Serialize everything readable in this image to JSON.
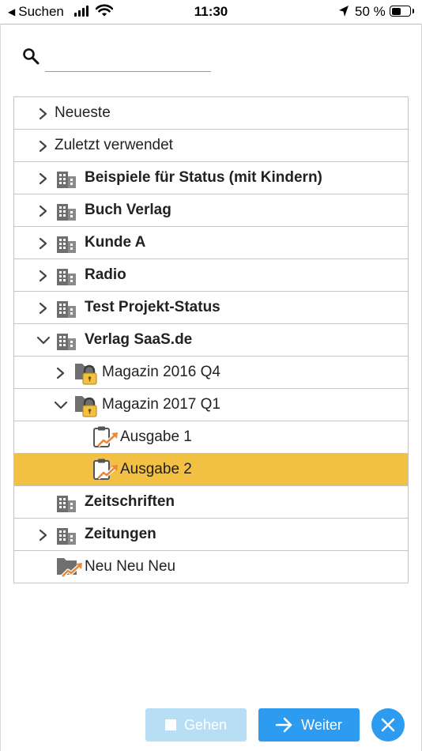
{
  "status_bar": {
    "back_label": "Suchen",
    "time": "11:30",
    "battery_percent": "50 %",
    "battery_level": 0.5
  },
  "search": {
    "value": "",
    "placeholder": ""
  },
  "tree": {
    "items": [
      {
        "label": "Neueste",
        "bold": false,
        "expander": "collapsed",
        "icon": "none"
      },
      {
        "label": "Zuletzt verwendet",
        "bold": false,
        "expander": "collapsed",
        "icon": "none"
      },
      {
        "label": "Beispiele für Status (mit Kindern)",
        "bold": true,
        "expander": "collapsed",
        "icon": "building-icon"
      },
      {
        "label": "Buch Verlag",
        "bold": true,
        "expander": "collapsed",
        "icon": "building-icon"
      },
      {
        "label": "Kunde A",
        "bold": true,
        "expander": "collapsed",
        "icon": "building-icon"
      },
      {
        "label": "Radio",
        "bold": true,
        "expander": "collapsed",
        "icon": "building-icon"
      },
      {
        "label": "Test Projekt-Status",
        "bold": true,
        "expander": "collapsed",
        "icon": "building-icon"
      },
      {
        "label": "Verlag SaaS.de",
        "bold": true,
        "expander": "expanded",
        "icon": "building-icon"
      },
      {
        "label": "Magazin 2016 Q4",
        "bold": false,
        "expander": "collapsed",
        "icon": "locked-folder-icon"
      },
      {
        "label": "Magazin 2017 Q1",
        "bold": false,
        "expander": "expanded",
        "icon": "locked-folder-icon"
      },
      {
        "label": "Ausgabe 1",
        "bold": false,
        "expander": "none",
        "icon": "clipboard-trend-icon"
      },
      {
        "label": "Ausgabe 2",
        "bold": false,
        "expander": "none",
        "icon": "clipboard-trend-icon",
        "selected": true
      },
      {
        "label": "Zeitschriften",
        "bold": true,
        "expander": "none",
        "icon": "building-icon"
      },
      {
        "label": "Zeitungen",
        "bold": true,
        "expander": "collapsed",
        "icon": "building-icon"
      },
      {
        "label": "Neu Neu Neu",
        "bold": false,
        "expander": "none",
        "icon": "folder-trend-icon"
      }
    ]
  },
  "buttons": {
    "gehen": "Gehen",
    "weiter": "Weiter"
  },
  "colors": {
    "selected_row": "#f2c043",
    "primary_button": "#2d9bf0",
    "disabled_button": "#b8def6"
  }
}
